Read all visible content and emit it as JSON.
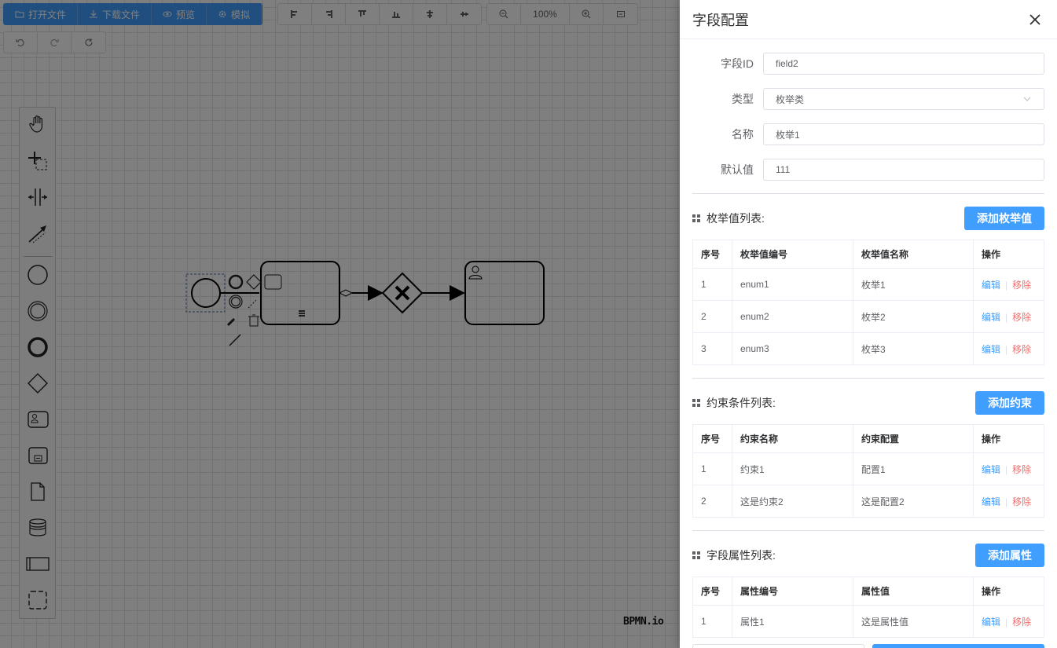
{
  "toolbar": {
    "file_group": [
      {
        "label": "打开文件",
        "icon": "folder-icon"
      },
      {
        "label": "下载文件",
        "icon": "download-icon"
      },
      {
        "label": "预览",
        "icon": "eye-icon"
      },
      {
        "label": "模拟",
        "icon": "gear-icon"
      }
    ],
    "zoom_level": "100%"
  },
  "logo": "BPMN.io",
  "drawer": {
    "title": "字段配置",
    "fields": {
      "id": {
        "label": "字段ID",
        "value": "field2"
      },
      "type": {
        "label": "类型",
        "value": "枚举类"
      },
      "name": {
        "label": "名称",
        "value": "枚举1"
      },
      "default": {
        "label": "默认值",
        "value": "111"
      }
    },
    "enum_section": {
      "title": "枚举值列表:",
      "add_label": "添加枚举值",
      "headers": [
        "序号",
        "枚举值编号",
        "枚举值名称",
        "操作"
      ],
      "rows": [
        {
          "idx": "1",
          "code": "enum1",
          "name": "枚举1"
        },
        {
          "idx": "2",
          "code": "enum2",
          "name": "枚举2"
        },
        {
          "idx": "3",
          "code": "enum3",
          "name": "枚举3"
        }
      ]
    },
    "constraint_section": {
      "title": "约束条件列表:",
      "add_label": "添加约束",
      "headers": [
        "序号",
        "约束名称",
        "约束配置",
        "操作"
      ],
      "rows": [
        {
          "idx": "1",
          "code": "约束1",
          "name": "配置1"
        },
        {
          "idx": "2",
          "code": "这是约束2",
          "name": "这是配置2"
        }
      ]
    },
    "property_section": {
      "title": "字段属性列表:",
      "add_label": "添加属性",
      "headers": [
        "序号",
        "属性编号",
        "属性值",
        "操作"
      ],
      "rows": [
        {
          "idx": "1",
          "code": "属性1",
          "name": "这是属性值"
        }
      ]
    },
    "op_edit": "编辑",
    "op_delete": "移除"
  }
}
